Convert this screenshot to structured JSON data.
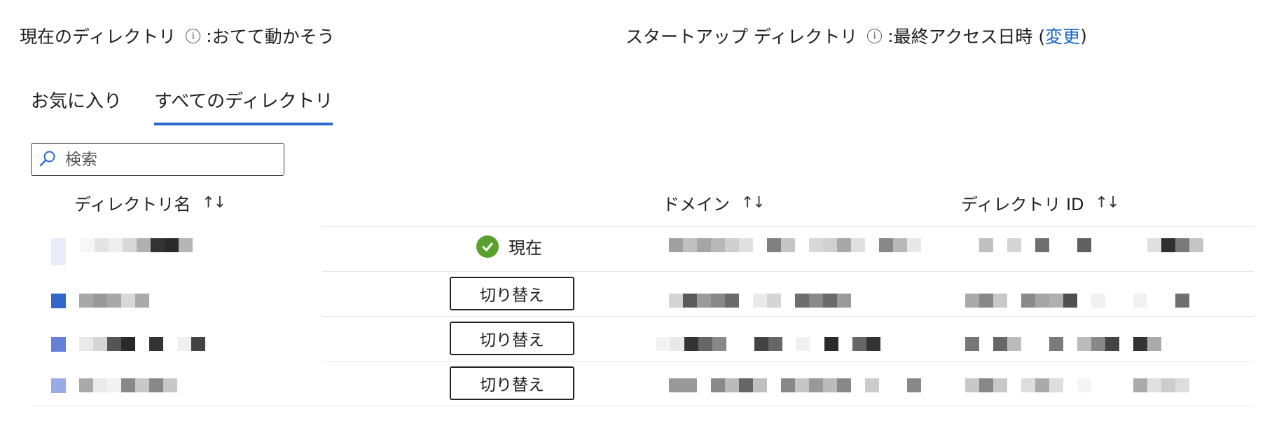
{
  "header": {
    "current_dir_label": "現在のディレクトリ",
    "current_dir_sep": ": ",
    "current_dir_value": "おてて動かそう",
    "startup_dir_label": "スタートアップ ディレクトリ",
    "startup_dir_sep": ": ",
    "startup_dir_value": "最終アクセス日時 (",
    "change_link": "変更",
    "close_paren": ")",
    "info_icon_glyph": "i"
  },
  "tabs": [
    {
      "label": "お気に入り",
      "active": false
    },
    {
      "label": "すべてのディレクトリ",
      "active": true
    }
  ],
  "search": {
    "placeholder": "検索"
  },
  "columns": {
    "name": "ディレクトリ名",
    "domain": "ドメイン",
    "dir_id": "ディレクトリ ID",
    "sort_icon": "↑↓"
  },
  "rows": [
    {
      "status": "現在",
      "action": null,
      "color": "#e8ecfa"
    },
    {
      "status": null,
      "action": "切り替え",
      "color": "#3366cc"
    },
    {
      "status": null,
      "action": "切り替え",
      "color": "#6680d8"
    },
    {
      "status": null,
      "action": "切り替え",
      "color": "#9aaae6"
    }
  ],
  "colors": {
    "accent": "#2a6acb",
    "link": "#1a66c9",
    "success": "#5aa02c"
  }
}
